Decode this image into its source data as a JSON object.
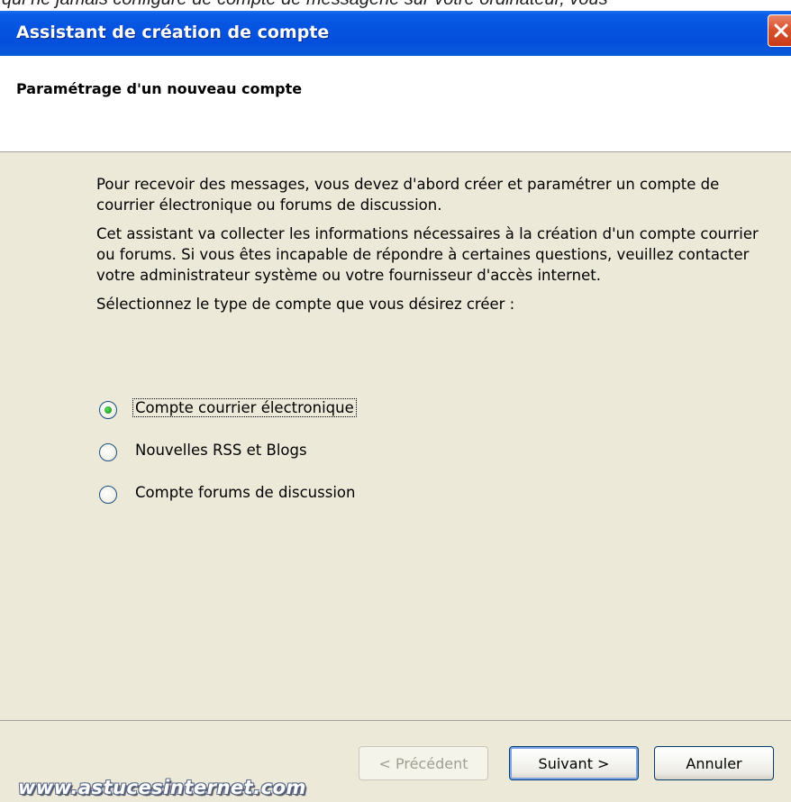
{
  "window": {
    "title": "Assistant de création de compte",
    "close_icon": "close-icon",
    "top_strip_text": "qui ne jamais configuré de compte de messagerie sur votre ordinateur, vous"
  },
  "header": {
    "title": "Paramétrage d'un nouveau compte"
  },
  "content": {
    "intro_paragraph_1": "Pour recevoir des messages, vous devez d'abord créer et paramétrer un compte de courrier électronique ou forums de discussion.",
    "intro_paragraph_2": "Cet assistant va collecter les informations nécessaires à la création d'un compte courrier ou forums. Si vous êtes incapable de répondre à certaines questions, veuillez contacter votre administrateur système ou votre fournisseur d'accès internet.",
    "prompt": "Sélectionnez le type de compte que vous désirez créer :",
    "account_types": [
      {
        "label": "Compte courrier électronique",
        "selected": true
      },
      {
        "label": "Nouvelles RSS et Blogs",
        "selected": false
      },
      {
        "label": "Compte forums de discussion",
        "selected": false
      }
    ]
  },
  "footer": {
    "back_label": "< Précédent",
    "next_label": "Suivant >",
    "cancel_label": "Annuler",
    "watermark": "www.astucesinternet.com"
  },
  "colors": {
    "titlebar": "#0553e0",
    "panel_background": "#ece9d8",
    "close_button": "#d8522e",
    "radio_selected": "#21a121"
  }
}
